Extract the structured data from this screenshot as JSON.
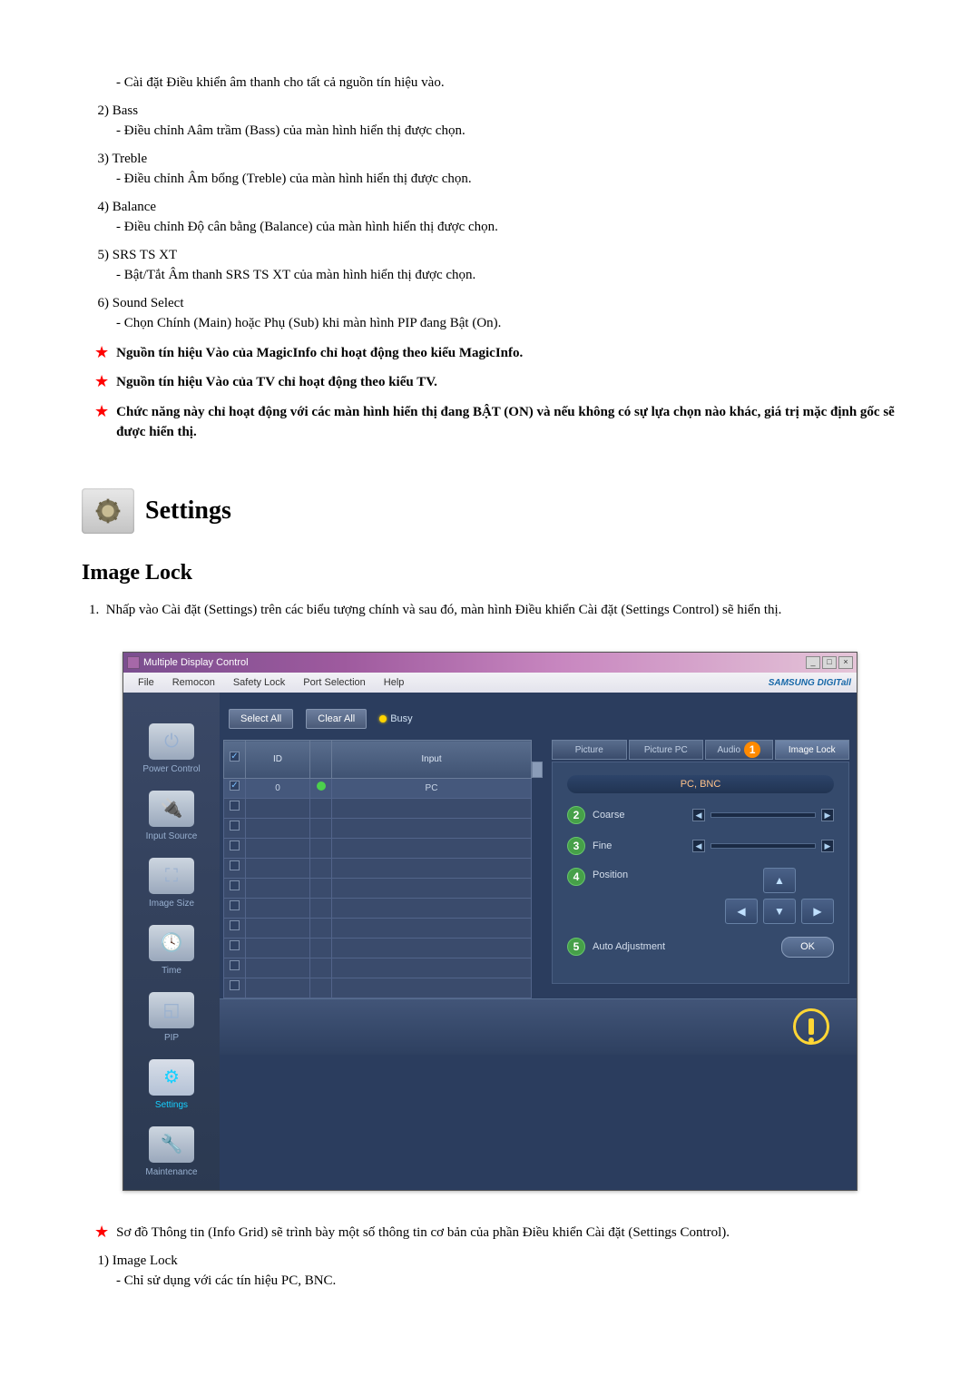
{
  "top_items": [
    {
      "indent_line": "- Cài đặt Điều khiển âm thanh cho tất cả nguồn tín hiệu vào.",
      "has_heading": false
    },
    {
      "num": "2)",
      "heading": "Bass",
      "line": "- Điều chỉnh Aâm trầm (Bass) của màn hình hiển thị được chọn.",
      "has_heading": true
    },
    {
      "num": "3)",
      "heading": "Treble",
      "line": "- Điều chỉnh Âm bổng (Treble) của màn hình hiển thị được chọn.",
      "has_heading": true
    },
    {
      "num": "4)",
      "heading": "Balance",
      "line": "- Điều chỉnh Độ cân bằng (Balance) của màn hình hiển thị được chọn.",
      "has_heading": true
    },
    {
      "num": "5)",
      "heading": "SRS TS XT",
      "line": "- Bật/Tắt Âm thanh SRS TS XT của màn hình hiển thị được chọn.",
      "has_heading": true
    },
    {
      "num": "6)",
      "heading": "Sound Select",
      "line": "- Chọn Chính (Main) hoặc Phụ (Sub) khi màn hình PIP đang Bật (On).",
      "has_heading": true
    }
  ],
  "star_notes": [
    "Nguồn tín hiệu Vào của MagicInfo chỉ hoạt động theo kiểu MagicInfo.",
    "Nguồn tín hiệu Vào của TV chỉ hoạt động theo kiểu TV.",
    "Chức năng này chỉ hoạt động với các màn hình hiển thị đang BẬT (ON) và nếu không có sự lựa chọn nào khác, giá trị mặc định gốc sẽ được hiển thị."
  ],
  "settings_heading": "Settings",
  "subsection": "Image Lock",
  "instruction_num": "1.",
  "instruction": "Nhấp vào Cài đặt (Settings) trên các biểu tượng chính và sau đó, màn hình Điều khiển Cài đặt (Settings Control) sẽ hiển thị.",
  "app": {
    "title": "Multiple Display Control",
    "menu": [
      "File",
      "Remocon",
      "Safety Lock",
      "Port Selection",
      "Help"
    ],
    "brand": "SAMSUNG DIGITall",
    "sidebar": [
      {
        "label": "Power Control"
      },
      {
        "label": "Input Source"
      },
      {
        "label": "Image Size"
      },
      {
        "label": "Time"
      },
      {
        "label": "PIP"
      },
      {
        "label": "Settings"
      },
      {
        "label": "Maintenance"
      }
    ],
    "toolbar": {
      "select_all": "Select All",
      "clear_all": "Clear All",
      "busy": "Busy"
    },
    "grid": {
      "headers": {
        "chk": "",
        "id": "ID",
        "status": "",
        "input": "Input"
      },
      "row0": {
        "id": "0",
        "input": "PC"
      },
      "blank_rows": 10
    },
    "tabs": [
      "Picture",
      "Picture PC",
      "Audio",
      "Image Lock"
    ],
    "active_tab_index": 3,
    "badge_num": "1",
    "mode_label": "PC, BNC",
    "controls": {
      "coarse": {
        "num": "2",
        "label": "Coarse"
      },
      "fine": {
        "num": "3",
        "label": "Fine"
      },
      "position": {
        "num": "4",
        "label": "Position"
      },
      "auto": {
        "num": "5",
        "label": "Auto Adjustment",
        "btn": "OK"
      }
    }
  },
  "bottom": {
    "star_note": "Sơ đồ Thông tin (Info Grid) sẽ trình bày một số thông tin cơ bản của phần Điều khiển Cài đặt (Settings Control).",
    "item_num": "1)",
    "item_heading": "Image Lock",
    "item_line": "- Chỉ sử dụng với các tín hiệu PC, BNC."
  }
}
